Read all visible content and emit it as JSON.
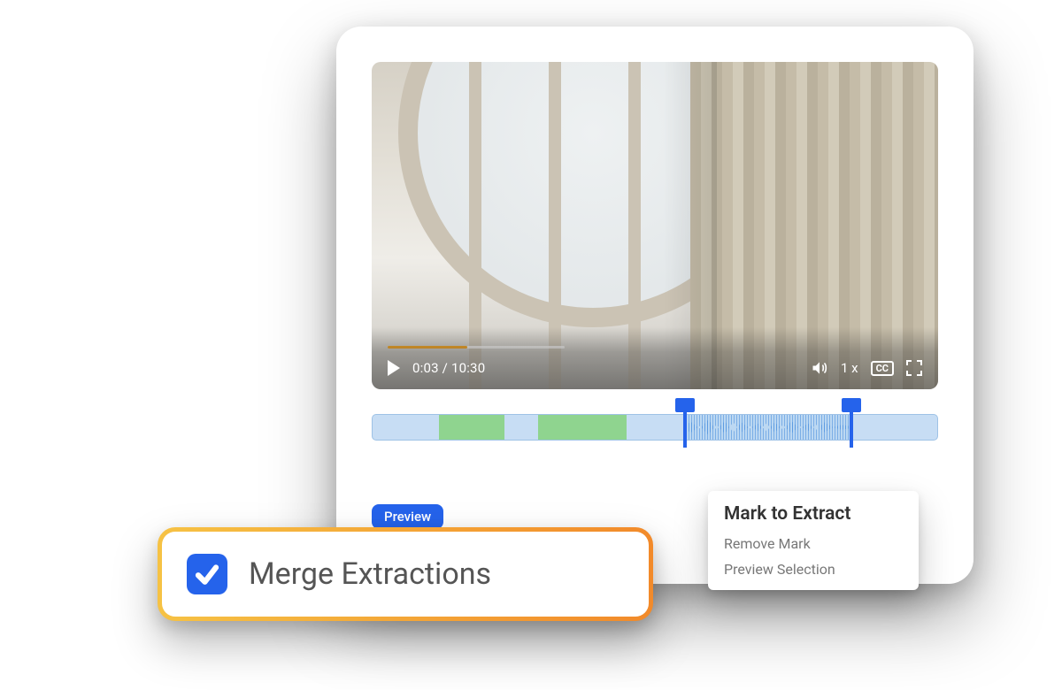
{
  "player": {
    "current_time": "0:03",
    "sep": " / ",
    "duration": "10:30",
    "speed": "1 x",
    "cc": "CC"
  },
  "preview_button": "Preview",
  "context_menu": {
    "primary": "Mark to Extract",
    "items": [
      "Remove Mark",
      "Preview Selection"
    ]
  },
  "merge": {
    "label": "Merge Extractions",
    "checked": true
  }
}
